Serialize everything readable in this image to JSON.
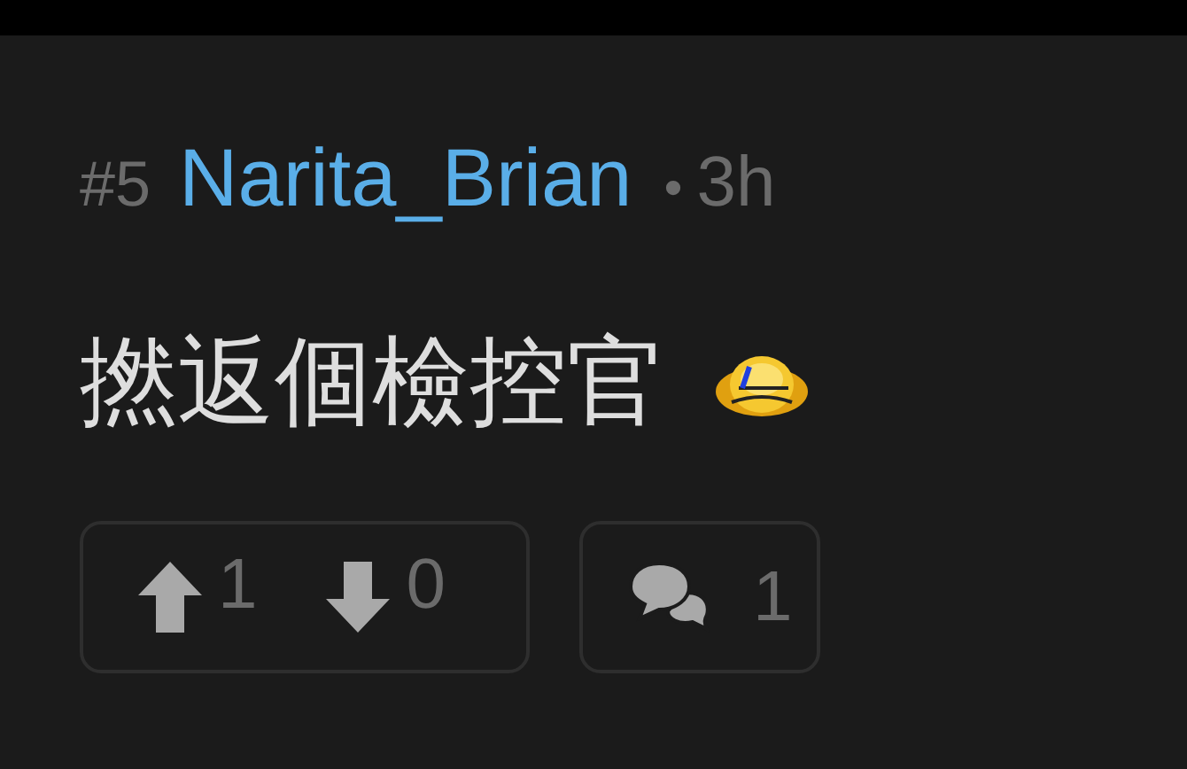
{
  "post": {
    "number": "#5",
    "author": "Narita_Brian",
    "separator": "•",
    "time": "3h",
    "body": "撚返個檢控官"
  },
  "votes": {
    "up": "1",
    "down": "0"
  },
  "replies": {
    "count": "1"
  }
}
